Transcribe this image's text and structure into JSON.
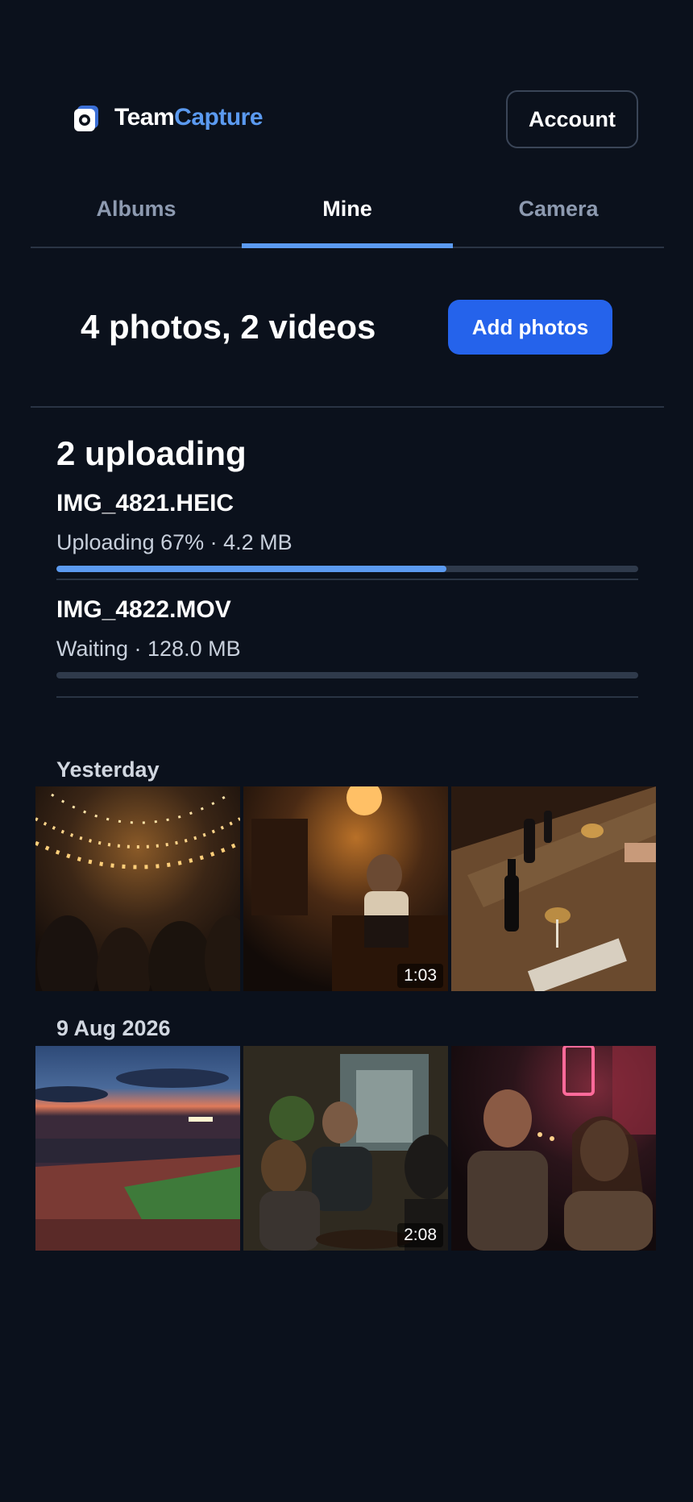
{
  "app": {
    "brand_part1": "Team",
    "brand_part2": "Capture",
    "accent_color": "#5b9af0",
    "primary_color": "#2563eb",
    "logo_icon": "camera-icon"
  },
  "header": {
    "account_label": "Account"
  },
  "tabs": [
    {
      "label": "Albums",
      "active": false
    },
    {
      "label": "Mine",
      "active": true
    },
    {
      "label": "Camera",
      "active": false
    }
  ],
  "summary": {
    "text": "4 photos, 2 videos",
    "add_label": "Add photos"
  },
  "uploads": {
    "title": "2 uploading",
    "items": [
      {
        "name": "IMG_4821.HEIC",
        "status": "Uploading 67% · 4.2 MB",
        "progress": 0.67
      },
      {
        "name": "IMG_4822.MOV",
        "status": "Waiting · 128.0 MB",
        "progress": 0.0
      }
    ]
  },
  "groups": [
    {
      "label": "Yesterday",
      "items": [
        {
          "kind": "photo",
          "scene": "festival-string-lights-crowd"
        },
        {
          "kind": "video",
          "scene": "bartender-pouring-drinks",
          "duration": "1:03"
        },
        {
          "kind": "photo",
          "scene": "wine-bottles-on-table"
        }
      ]
    },
    {
      "label": "9 Aug 2026",
      "items": [
        {
          "kind": "photo",
          "scene": "stadium-at-dusk"
        },
        {
          "kind": "video",
          "scene": "friends-talking-at-bar",
          "duration": "2:08"
        },
        {
          "kind": "photo",
          "scene": "couple-laughing-at-night"
        }
      ]
    }
  ]
}
